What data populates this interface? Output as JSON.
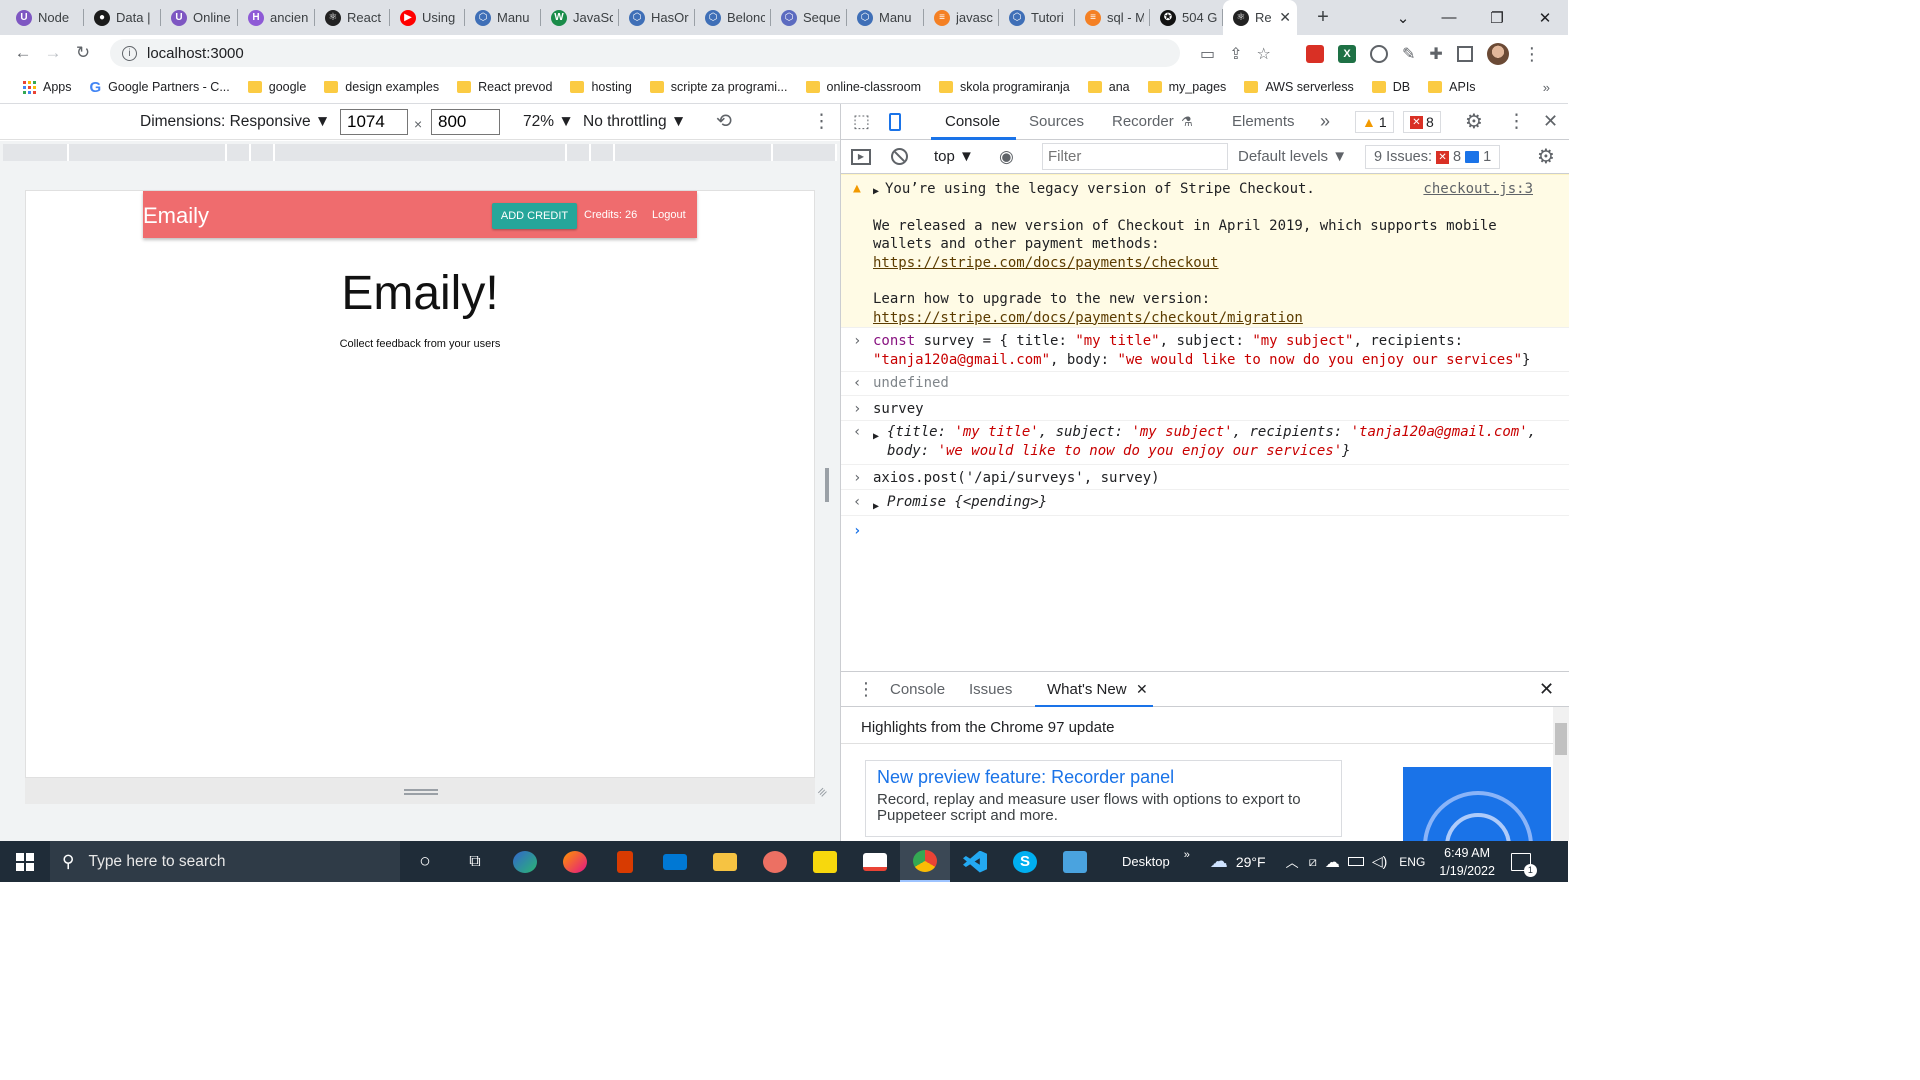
{
  "browser": {
    "tabs": [
      {
        "title": "Node",
        "favicon_color": "#7e57c2",
        "favicon_glyph": "U"
      },
      {
        "title": "Data |",
        "favicon_color": "#1b1b1b",
        "favicon_glyph": "●"
      },
      {
        "title": "Online",
        "favicon_color": "#7e57c2",
        "favicon_glyph": "U"
      },
      {
        "title": "ancien",
        "favicon_color": "#8e5ad6",
        "favicon_glyph": "H"
      },
      {
        "title": "React",
        "favicon_color": "#222",
        "favicon_glyph": "⚛"
      },
      {
        "title": "Using",
        "favicon_color": "#ff0000",
        "favicon_glyph": "▶"
      },
      {
        "title": "Manu",
        "favicon_color": "#3f6fb7",
        "favicon_glyph": "⬡"
      },
      {
        "title": "JavaSc",
        "favicon_color": "#1a8c4a",
        "favicon_glyph": "W"
      },
      {
        "title": "HasOr",
        "favicon_color": "#3f6fb7",
        "favicon_glyph": "⬡"
      },
      {
        "title": "Belonc",
        "favicon_color": "#3f6fb7",
        "favicon_glyph": "⬡"
      },
      {
        "title": "Seque",
        "favicon_color": "#5c6bc0",
        "favicon_glyph": "⬡"
      },
      {
        "title": "Manu",
        "favicon_color": "#3f6fb7",
        "favicon_glyph": "⬡"
      },
      {
        "title": "javasc",
        "favicon_color": "#f48024",
        "favicon_glyph": "≡"
      },
      {
        "title": "Tutori",
        "favicon_color": "#3f6fb7",
        "favicon_glyph": "⬡"
      },
      {
        "title": "sql - M",
        "favicon_color": "#f48024",
        "favicon_glyph": "≡"
      },
      {
        "title": "504 G",
        "favicon_color": "#111",
        "favicon_glyph": "✪"
      },
      {
        "title": "Re",
        "favicon_color": "#222",
        "favicon_glyph": "⚛",
        "active": true
      }
    ],
    "new_tab": "+",
    "url": "localhost:3000",
    "bookmarks": [
      {
        "label": "Apps",
        "type": "apps"
      },
      {
        "label": "Google Partners - C...",
        "type": "google"
      },
      {
        "label": "google",
        "type": "folder"
      },
      {
        "label": "design examples",
        "type": "folder"
      },
      {
        "label": "React prevod",
        "type": "folder"
      },
      {
        "label": "hosting",
        "type": "folder"
      },
      {
        "label": "scripte za programi...",
        "type": "folder"
      },
      {
        "label": "online-classroom",
        "type": "folder"
      },
      {
        "label": "skola programiranja",
        "type": "folder"
      },
      {
        "label": "ana",
        "type": "folder"
      },
      {
        "label": "my_pages",
        "type": "folder"
      },
      {
        "label": "AWS serverless",
        "type": "folder"
      },
      {
        "label": "DB",
        "type": "folder"
      },
      {
        "label": "APIs",
        "type": "folder"
      }
    ],
    "more_bookmarks": "»"
  },
  "device_toolbar": {
    "dimensions_label": "Dimensions: Responsive ▼",
    "width": "1074",
    "times": "×",
    "height": "800",
    "zoom": "72% ▼",
    "throttling": "No throttling ▼"
  },
  "app": {
    "brand": "Emaily",
    "add_credit": "ADD CREDIT",
    "credits": "Credits: 26",
    "logout": "Logout",
    "heading": "Emaily!",
    "subheading": "Collect feedback from your users",
    "colors": {
      "nav": "#ef6c6e",
      "button": "#26a69a"
    }
  },
  "devtools": {
    "tabs": [
      "Console",
      "Sources",
      "Recorder",
      "Elements"
    ],
    "more_tabs": "»",
    "warning_count": "1",
    "error_count": "8",
    "context": "top ▼",
    "filter_placeholder": "Filter",
    "levels": "Default levels ▼",
    "issues_label": "9 Issues:",
    "issues_errors": "8",
    "issues_info": "1",
    "console": {
      "warning_line1": "You’re using the legacy version of Stripe Checkout.",
      "warning_source": "checkout.js:3",
      "warning_line2": "We released a new version of Checkout in April 2019, which supports mobile wallets and other payment methods:",
      "warning_link1": "https://stripe.com/docs/payments/checkout",
      "warning_line3": "Learn how to upgrade to the new version:",
      "warning_link2": "https://stripe.com/docs/payments/checkout/migration",
      "cmd1_kw": "const",
      "cmd1_a": " survey = { title: ",
      "cmd1_s1": "\"my title\"",
      "cmd1_b": ", subject: ",
      "cmd1_s2": "\"my subject\"",
      "cmd1_c": ", recipients: ",
      "cmd1_s3": "\"tanja120a@gmail.com\"",
      "cmd1_d": ", body: ",
      "cmd1_s4": "\"we would like to now do you enjoy our services\"",
      "cmd1_e": "}",
      "result1": "undefined",
      "cmd2": "survey",
      "obj_open": "{title: ",
      "obj_s1": "'my title'",
      "obj_k2": ", subject: ",
      "obj_s2": "'my subject'",
      "obj_k3": ", recipients: ",
      "obj_s3": "'tanja120a@gmail.com'",
      "obj_k4": ", body: ",
      "obj_s4": "'we would like to now do you enjoy our services'",
      "obj_close": "}",
      "cmd3": "axios.post('/api/surveys', survey)",
      "result3": "Promise {<pending>}"
    },
    "drawer_tabs": [
      "Console",
      "Issues",
      "What's New"
    ],
    "whats_new_title": "Highlights from the Chrome 97 update",
    "feature_title": "New preview feature: Recorder panel",
    "feature_desc": "Record, replay and measure user flows with options to export to Puppeteer script and more."
  },
  "taskbar": {
    "search_placeholder": "Type here to search",
    "desktop_label": "Desktop",
    "weather": "29°F",
    "language": "ENG",
    "time": "6:49 AM",
    "date": "1/19/2022",
    "notification_count": "1"
  }
}
